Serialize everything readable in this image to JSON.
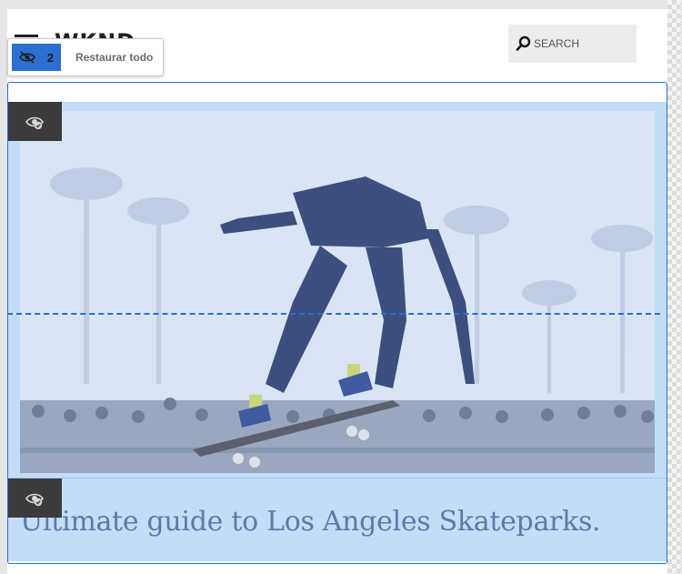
{
  "header": {
    "logo": "WKND",
    "search_placeholder": "SEARCH"
  },
  "hidden_components": {
    "count": "2",
    "restore_label": "Restaurar todo"
  },
  "article": {
    "title": "Ultimate guide to Los Angeles Skateparks."
  },
  "colors": {
    "accent": "#2c6fd1",
    "selection_overlay": "#c3dcf8",
    "badge": "#3b3b3b"
  }
}
